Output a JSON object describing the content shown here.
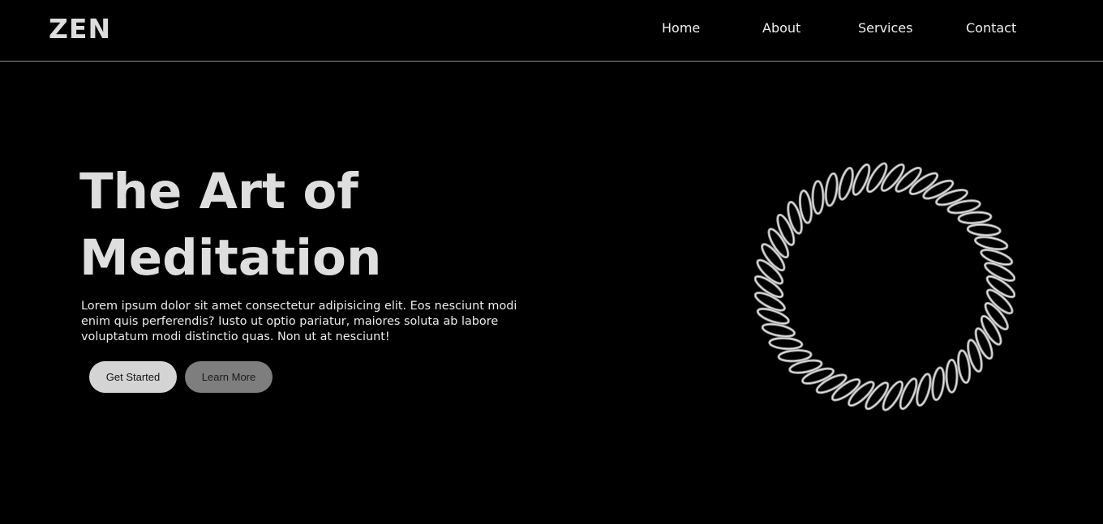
{
  "brand": {
    "logo": "ZEN"
  },
  "nav": {
    "items": [
      {
        "label": "Home"
      },
      {
        "label": "About"
      },
      {
        "label": "Services"
      },
      {
        "label": "Contact"
      }
    ]
  },
  "hero": {
    "title_line1": "The Art of",
    "title_line2": "Meditation",
    "description": "Lorem ipsum dolor sit amet consectetur adipisicing elit. Eos nesciunt modi enim quis perferendis? Iusto ut optio pariatur, maiores soluta ab labore voluptatum modi distinctio quas. Non ut at nesciunt!",
    "primary_button": "Get Started",
    "secondary_button": "Learn More"
  },
  "graphic": {
    "icon": "twisted-rope-ring-icon"
  },
  "colors": {
    "background": "#000000",
    "text": "#e2e2e2",
    "primary_button": "#d4d4d4",
    "secondary_button": "#7e7e7e",
    "divider": "#8a8a8a"
  }
}
